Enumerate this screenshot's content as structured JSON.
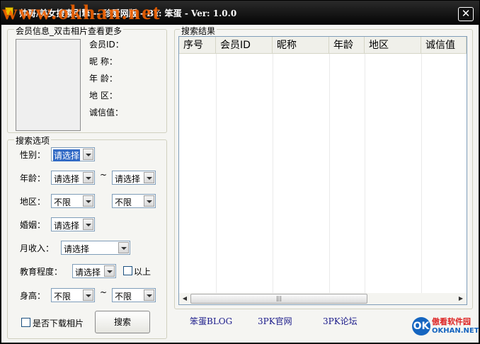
{
  "window": {
    "title": "帅哥/美女搜索引擎 -- 珍爱网版 - BY: 笨蛋 - Ver: 1.0.0",
    "watermark": "www.okhan.net",
    "close_label": "✕"
  },
  "member_info": {
    "group_title": "会员信息_双击相片查看更多",
    "labels": [
      "会员ID：",
      "昵  称：",
      "年  龄：",
      "地  区：",
      "诚信值："
    ]
  },
  "search_options": {
    "group_title": "搜索选项",
    "gender": {
      "label": "性别：",
      "value": "请选择"
    },
    "age": {
      "label": "年龄：",
      "from": "请选择",
      "to": "请选择",
      "separator": "~"
    },
    "region": {
      "label": "地区：",
      "from": "不限",
      "to": "不限"
    },
    "marriage": {
      "label": "婚姻：",
      "value": "请选择"
    },
    "income": {
      "label": "月收入：",
      "value": "请选择"
    },
    "education": {
      "label": "教育程度：",
      "value": "请选择",
      "above_label": "以上"
    },
    "height": {
      "label": "身高：",
      "from": "不限",
      "to": "不限",
      "separator": "~"
    },
    "download_photos_label": "是否下载相片",
    "search_button": "搜索"
  },
  "results": {
    "group_title": "搜索结果",
    "columns": [
      "序号",
      "会员ID",
      "昵称",
      "年龄",
      "地区",
      "诚信值"
    ],
    "rows": []
  },
  "footer_links": [
    "笨蛋BLOG",
    "3PK官网",
    "3PK论坛"
  ],
  "logo": {
    "mark": "OK",
    "top": "傲看软件园",
    "bottom": "OKHAN.NET"
  }
}
